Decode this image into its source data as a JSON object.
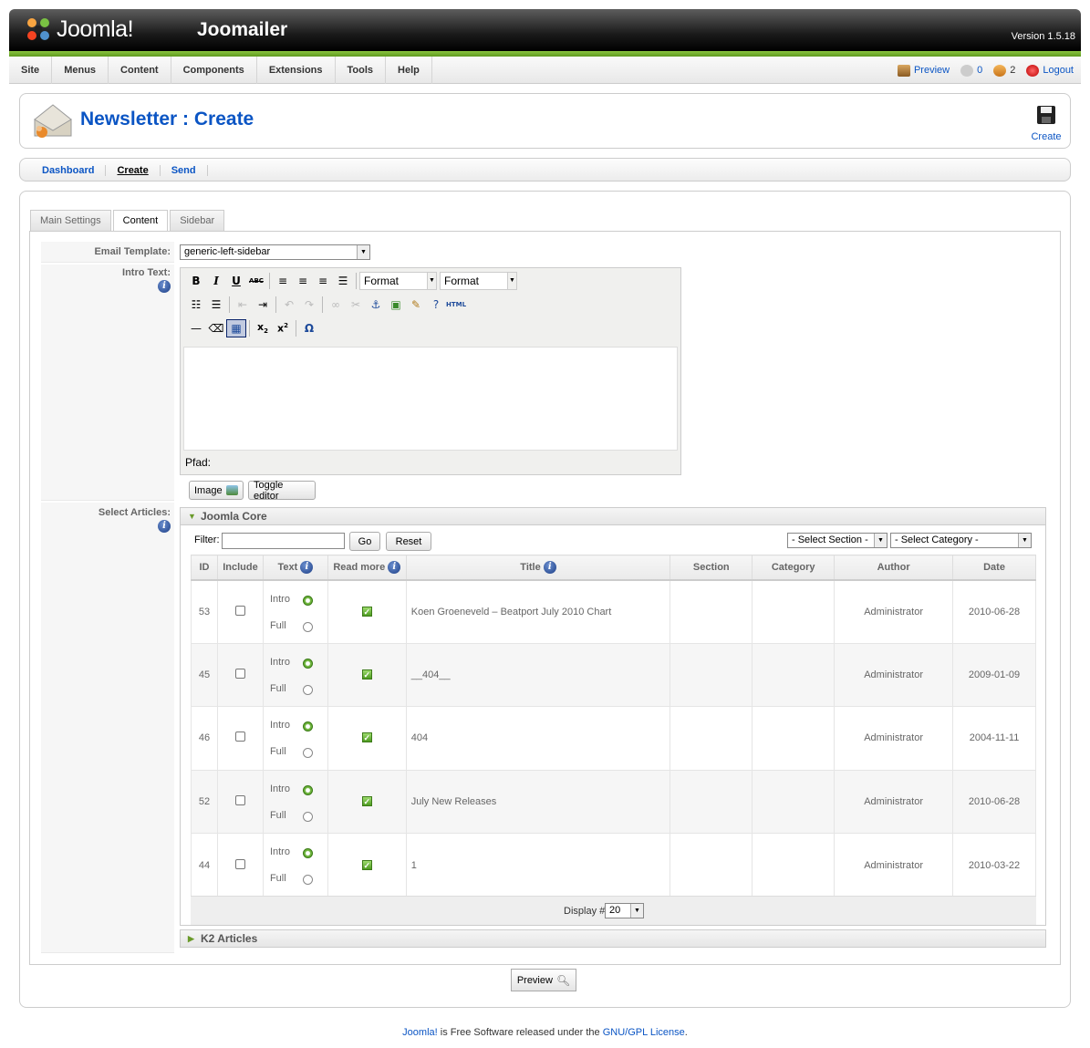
{
  "header": {
    "brand": "Joomla!",
    "app_name": "Joomailer",
    "version": "Version 1.5.18"
  },
  "menubar": {
    "items": [
      "Site",
      "Menus",
      "Content",
      "Components",
      "Extensions",
      "Tools",
      "Help"
    ],
    "preview": "Preview",
    "messages_count": "0",
    "users_count": "2",
    "logout": "Logout"
  },
  "toolbar": {
    "title": "Newsletter : Create",
    "create_label": "Create"
  },
  "submenu": {
    "items": [
      "Dashboard",
      "Create",
      "Send"
    ],
    "active": "Create"
  },
  "tabs": [
    "Main Settings",
    "Content",
    "Sidebar"
  ],
  "form": {
    "email_template_label": "Email Template:",
    "email_template_value": "generic-left-sidebar",
    "intro_text_label": "Intro Text:",
    "editor_format1": "Format",
    "editor_format2": "Format",
    "editor_path": "Pfad:",
    "image_button": "Image",
    "toggle_editor_button": "Toggle editor",
    "select_articles_label": "Select Articles:"
  },
  "articles_pane": {
    "title": "Joomla Core",
    "filter_label": "Filter:",
    "filter_value": "",
    "go_button": "Go",
    "reset_button": "Reset",
    "section_select": "- Select Section -",
    "category_select": "- Select Category -",
    "columns": [
      "ID",
      "Include",
      "Text",
      "Read more",
      "Title",
      "Section",
      "Category",
      "Author",
      "Date"
    ],
    "intro_label": "Intro",
    "full_label": "Full",
    "rows": [
      {
        "id": "53",
        "title": "Koen Groeneveld – Beatport July 2010 Chart",
        "section": "",
        "category": "",
        "author": "Administrator",
        "date": "2010-06-28"
      },
      {
        "id": "45",
        "title": "__404__",
        "section": "",
        "category": "",
        "author": "Administrator",
        "date": "2009-01-09"
      },
      {
        "id": "46",
        "title": "404",
        "section": "",
        "category": "",
        "author": "Administrator",
        "date": "2004-11-11"
      },
      {
        "id": "52",
        "title": "July New Releases",
        "section": "",
        "category": "",
        "author": "Administrator",
        "date": "2010-06-28"
      },
      {
        "id": "44",
        "title": "1",
        "section": "",
        "category": "",
        "author": "Administrator",
        "date": "2010-03-22"
      }
    ],
    "display_label": "Display #",
    "display_value": "20"
  },
  "k2_pane": {
    "title": "K2 Articles"
  },
  "preview_button": "Preview",
  "footer": {
    "link1": "Joomla!",
    "middle": " is Free Software released under the ",
    "link2": "GNU/GPL License",
    "end": "."
  }
}
